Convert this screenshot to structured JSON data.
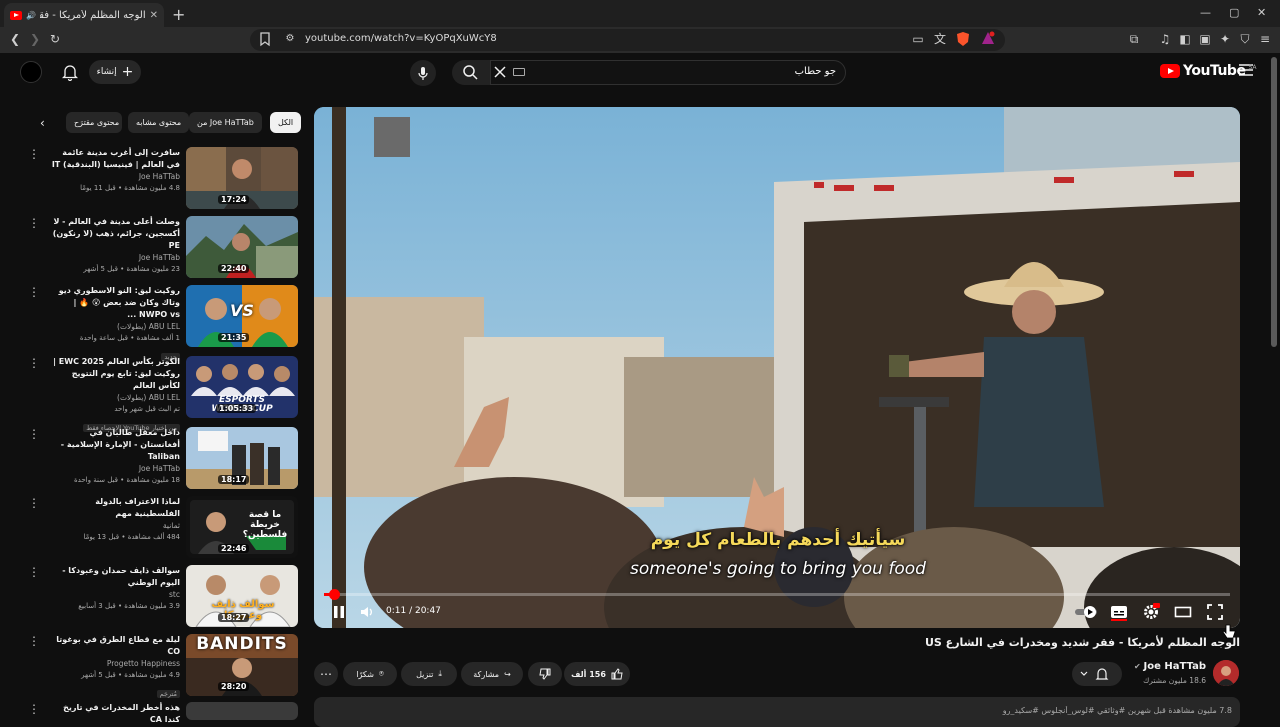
{
  "browser": {
    "tab_title": "الوجه المظلم لأمريكا - فقر شد...",
    "new_tab_icon": "plus-icon",
    "url": "youtube.com/watch?v=KyOPqXuWcY8",
    "window_controls": [
      "—",
      "▢",
      "✕"
    ]
  },
  "header": {
    "logo_text": "YouTube",
    "logo_region": "SA",
    "search_value": "جو حطاب",
    "create_label": "إنشاء"
  },
  "chips": [
    "الكل",
    "من Joe HaTTab",
    "محتوى مشابه",
    "محتوى مقترَح"
  ],
  "recommendations": [
    {
      "title": "سافرت إلى أغرب مدينة عائمة في العالم | فينيسيا (البندقية) IT",
      "channel": "Joe HaTTab",
      "stats": "4.8 مليون مشاهدة • قبل 11 يومًا",
      "duration": "17:24"
    },
    {
      "title": "وصلت أعلى مدينة في العالم - لا أكسجين، جرائم، ذهب (لا رنكون) PE",
      "channel": "Joe HaTTab",
      "stats": "23 مليون مشاهدة • قبل 5 أشهر",
      "duration": "22:40"
    },
    {
      "title": "روكيت ليق: النو الاسطوري ديو وتاك وكان ضد بعض 😮 🔥 | NWPO vs ...",
      "channel": "ABU LEL (يطولات)",
      "stats": "1 ألف مشاهدة • قبل ساعة واحدة",
      "badge": "جديد",
      "duration": "21:35"
    },
    {
      "title": "الكوتر بكأس العالم EWC 2025 | روكيت ليق: تابع يوم التتويج لكأس العالم",
      "channel": "ABU LEL (يطولات)",
      "stats": "تم البث قبل شهر واحد",
      "badge": "من اختيار YouTube  الإحصاء فقط",
      "duration": "1:05:33"
    },
    {
      "title": "داخل معقل طالبان في أفغانستان - الإمارة الإسلامية - Taliban",
      "channel": "Joe HaTTab",
      "stats": "18 مليون مشاهدة • قبل سنة واحدة",
      "duration": "18:17"
    },
    {
      "title": "لماذا الاعتراف بالدولة الفلسطينية مهم",
      "channel": "ثمانية",
      "stats": "484 ألف مشاهدة • قبل 13 يومًا",
      "duration": "22:46"
    },
    {
      "title": "سوالف ذايف حمدان وعبودكا - اليوم الوطني",
      "channel": "stc",
      "stats": "3.9 مليون مشاهدة • قبل 3 أسابيع",
      "duration": "18:27"
    },
    {
      "title": "ليلة مع قطاع الطرق في بوغوتا CO",
      "channel": "Progetto Happiness",
      "stats": "4.9 مليون مشاهدة • قبل 5 أشهر",
      "badge": "مُترجَم",
      "duration": "28:20"
    },
    {
      "title": "هذه أخطر المخدرات في تاريخ كندا CA",
      "channel": "",
      "stats": "",
      "duration": ""
    }
  ],
  "thumb_text": {
    "vs": "VS",
    "esports": "ESPORTS WORLD CUP",
    "palestine": "ما قصة خريطة فلسطين؟",
    "sawalef": "سوالف ذايف وعبودكا",
    "bandits": "BANDITS"
  },
  "player": {
    "subtitle_ar": "سيأتيك أحدهم بالطعام كل يوم",
    "subtitle_en": "someone's going to bring you food",
    "time": "0:11 / 20:47",
    "progress": 0.009
  },
  "video": {
    "title": "الوجه المظلم لأمريكا - فقر شديد ومخدرات في الشارع US",
    "channel": "Joe HaTTab",
    "subscribers": "18.6 مليون مشترك",
    "likes": "156 ألف",
    "share_label": "مشاركة",
    "download_label": "تنزيل",
    "thanks_label": "شكرًا",
    "description": "7.8 مليون مشاهدة  قبل شهرين  #وثائقي #لوس_أنجلوس #سكيد_رو"
  },
  "colors": {
    "brand": "#ff0000",
    "bg": "#0f0f0f",
    "chip": "#272727"
  }
}
